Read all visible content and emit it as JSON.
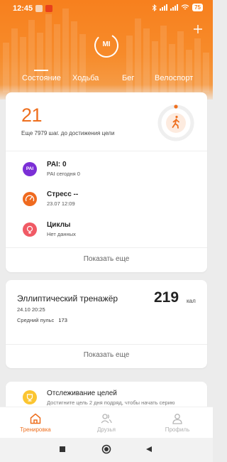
{
  "status_bar": {
    "time": "12:45",
    "battery": "75",
    "notif_colors": [
      "#f4d0b0",
      "#e53b1a"
    ]
  },
  "header": {
    "logo_text": "MI",
    "add_icon": "plus-icon",
    "tabs": [
      {
        "label": "Состояние",
        "active": true
      },
      {
        "label": "Ходьба",
        "active": false
      },
      {
        "label": "Бег",
        "active": false
      },
      {
        "label": "Велоспорт",
        "active": false
      }
    ]
  },
  "summary": {
    "steps": "21",
    "steps_caption": "Еще 7979 шаг. до достижения цели",
    "steps_progress": 0.0026,
    "accent": "#ee6f1e"
  },
  "metrics": [
    {
      "icon": "pai-icon",
      "icon_text": "PAI",
      "title": "PAI: 0",
      "sub": "PAI сегодня 0",
      "color": "#7b2fd6"
    },
    {
      "icon": "stress-gauge-icon",
      "title": "Стресс --",
      "sub": "23.07 12:09",
      "color": "#ef6a1f"
    },
    {
      "icon": "cycles-flower-icon",
      "title": "Циклы",
      "sub": "Нет данных",
      "color": "#f05a65"
    }
  ],
  "show_more_1": "Показать еще",
  "workout": {
    "title": "Эллиптический тренажёр",
    "value": "219",
    "unit": "кал",
    "date": "24.10 20:25",
    "pulse_label": "Средний пульс",
    "pulse_value": "173"
  },
  "show_more_2": "Показать еще",
  "goals": {
    "title": "Отслеживание целей",
    "desc": "Достигните цель 2 дня подряд, чтобы начать серию"
  },
  "bottom_nav": [
    {
      "label": "Тренировка",
      "icon": "home-icon",
      "active": true
    },
    {
      "label": "Друзья",
      "icon": "friends-icon",
      "active": false
    },
    {
      "label": "Профиль",
      "icon": "profile-icon",
      "active": false
    }
  ]
}
